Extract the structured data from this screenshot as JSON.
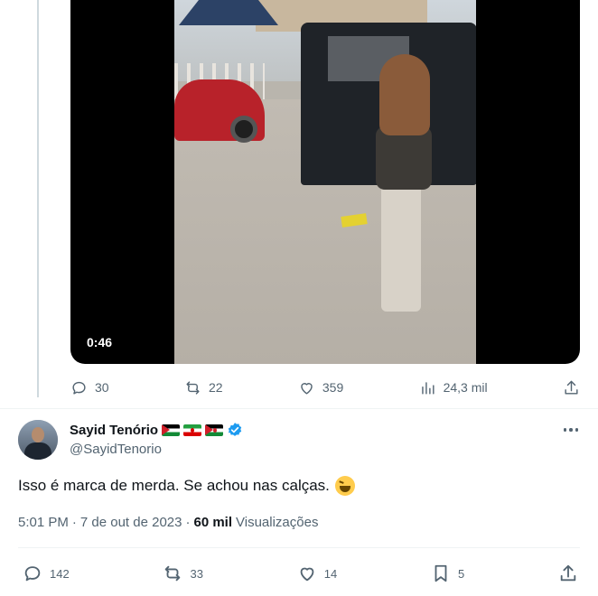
{
  "video": {
    "duration": "0:46"
  },
  "quoted_actions": {
    "replies": "30",
    "reposts": "22",
    "likes": "359",
    "views": "24,3 mil"
  },
  "reply": {
    "author_name": "Sayid Tenório",
    "handle": "@SayidTenorio",
    "text": "Isso é marca de merda. Se achou nas calças.",
    "emoji": "grinning-squinting-face",
    "time": "5:01 PM",
    "separator": "·",
    "date": "7 de out de 2023",
    "views_count": "60 mil",
    "views_label": "Visualizações",
    "flags": [
      "palestine-flag",
      "iran-flag",
      "western-sahara-flag"
    ],
    "verified_color": "#1d9bf0"
  },
  "reply_actions": {
    "replies": "142",
    "reposts": "33",
    "likes": "14",
    "bookmarks": "5"
  }
}
